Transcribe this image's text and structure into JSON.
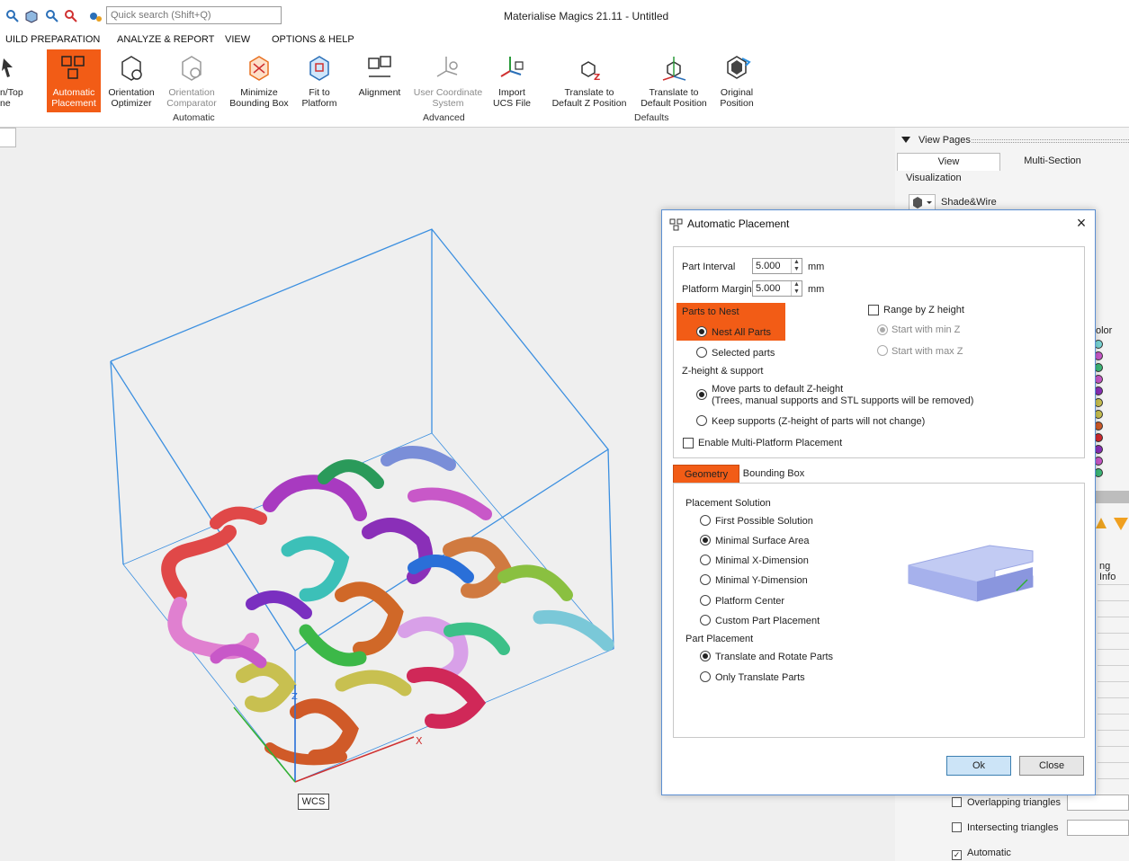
{
  "app": {
    "title": "Materialise Magics 21.11 - Untitled"
  },
  "quick_search": {
    "placeholder": "Quick search (Shift+Q)"
  },
  "menu": [
    "UILD PREPARATION",
    "ANALYZE & REPORT",
    "VIEW",
    "OPTIONS & HELP"
  ],
  "ribbon": {
    "buttons": [
      {
        "label1": "n/Top",
        "label2": "ne",
        "state": "normal"
      },
      {
        "label1": "Automatic",
        "label2": "Placement",
        "state": "active"
      },
      {
        "label1": "Orientation",
        "label2": "Optimizer",
        "state": "normal"
      },
      {
        "label1": "Orientation",
        "label2": "Comparator",
        "state": "dim"
      },
      {
        "label1": "Minimize",
        "label2": "Bounding Box",
        "state": "normal"
      },
      {
        "label1": "Fit to",
        "label2": "Platform",
        "state": "normal"
      },
      {
        "label1": "Alignment",
        "label2": "",
        "state": "normal"
      },
      {
        "label1": "User Coordinate",
        "label2": "System",
        "state": "dim"
      },
      {
        "label1": "Import",
        "label2": "UCS File",
        "state": "normal"
      },
      {
        "label1": "Translate to",
        "label2": "Default Z Position",
        "state": "normal"
      },
      {
        "label1": "Translate to",
        "label2": "Default Position",
        "state": "normal"
      },
      {
        "label1": "Original",
        "label2": "Position",
        "state": "normal"
      }
    ],
    "groups": [
      "Automatic",
      "Advanced",
      "Defaults"
    ]
  },
  "viewport": {
    "wcs_label": "WCS",
    "axis_x": "X",
    "axis_z": "Z"
  },
  "right_panel": {
    "view_pages": "View Pages",
    "tabs": [
      "View",
      "Multi-Section"
    ],
    "visualization": "Visualization",
    "shade_mode": "Shade&Wire",
    "color_label": "olor",
    "info_label": "ng Info",
    "checks": [
      {
        "label": "Overlapping triangles",
        "checked": false
      },
      {
        "label": "Intersecting triangles",
        "checked": false
      },
      {
        "label": "Automatic",
        "checked": true
      }
    ],
    "dot_colors": [
      "#7ad7d7",
      "#c858c8",
      "#3cb878",
      "#c858c8",
      "#8a2fb8",
      "#c8c050",
      "#c8c050",
      "#d05a28",
      "#d02830",
      "#8a2fb8",
      "#c858c8",
      "#3cb878"
    ]
  },
  "dialog": {
    "title": "Automatic Placement",
    "part_interval": {
      "label": "Part Interval",
      "value": "5.000",
      "unit": "mm"
    },
    "platform_margin": {
      "label": "Platform Margin",
      "value": "5.000",
      "unit": "mm"
    },
    "parts_to_nest": {
      "heading": "Parts to Nest",
      "options": [
        {
          "label": "Nest All Parts",
          "selected": true
        },
        {
          "label": "Selected parts",
          "selected": false
        }
      ]
    },
    "range_by_z": {
      "label": "Range by Z height",
      "checked": false,
      "options": [
        {
          "label": "Start with min Z",
          "selected": true
        },
        {
          "label": "Start with max Z",
          "selected": false
        }
      ]
    },
    "z_height": {
      "heading": "Z-height & support",
      "move_line1": "Move parts to default Z-height",
      "move_line2": "(Trees, manual supports and STL supports will be removed)",
      "keep": "Keep supports (Z-height of parts will not change)"
    },
    "multi_platform": {
      "label": "Enable Multi-Platform Placement",
      "checked": false
    },
    "tabs": [
      "Geometry",
      "Bounding Box"
    ],
    "placement_solution": {
      "heading": "Placement Solution",
      "options": [
        {
          "label": "First Possible Solution",
          "selected": false
        },
        {
          "label": "Minimal Surface Area",
          "selected": true
        },
        {
          "label": "Minimal X-Dimension",
          "selected": false
        },
        {
          "label": "Minimal Y-Dimension",
          "selected": false
        },
        {
          "label": "Platform Center",
          "selected": false
        },
        {
          "label": "Custom Part Placement",
          "selected": false
        }
      ]
    },
    "part_placement": {
      "heading": "Part Placement",
      "options": [
        {
          "label": "Translate and Rotate Parts",
          "selected": true
        },
        {
          "label": "Only Translate Parts",
          "selected": false
        }
      ]
    },
    "ok": "Ok",
    "close": "Close"
  },
  "colors": {
    "accent": "#f25c16",
    "wire": "#3b8fe0"
  }
}
